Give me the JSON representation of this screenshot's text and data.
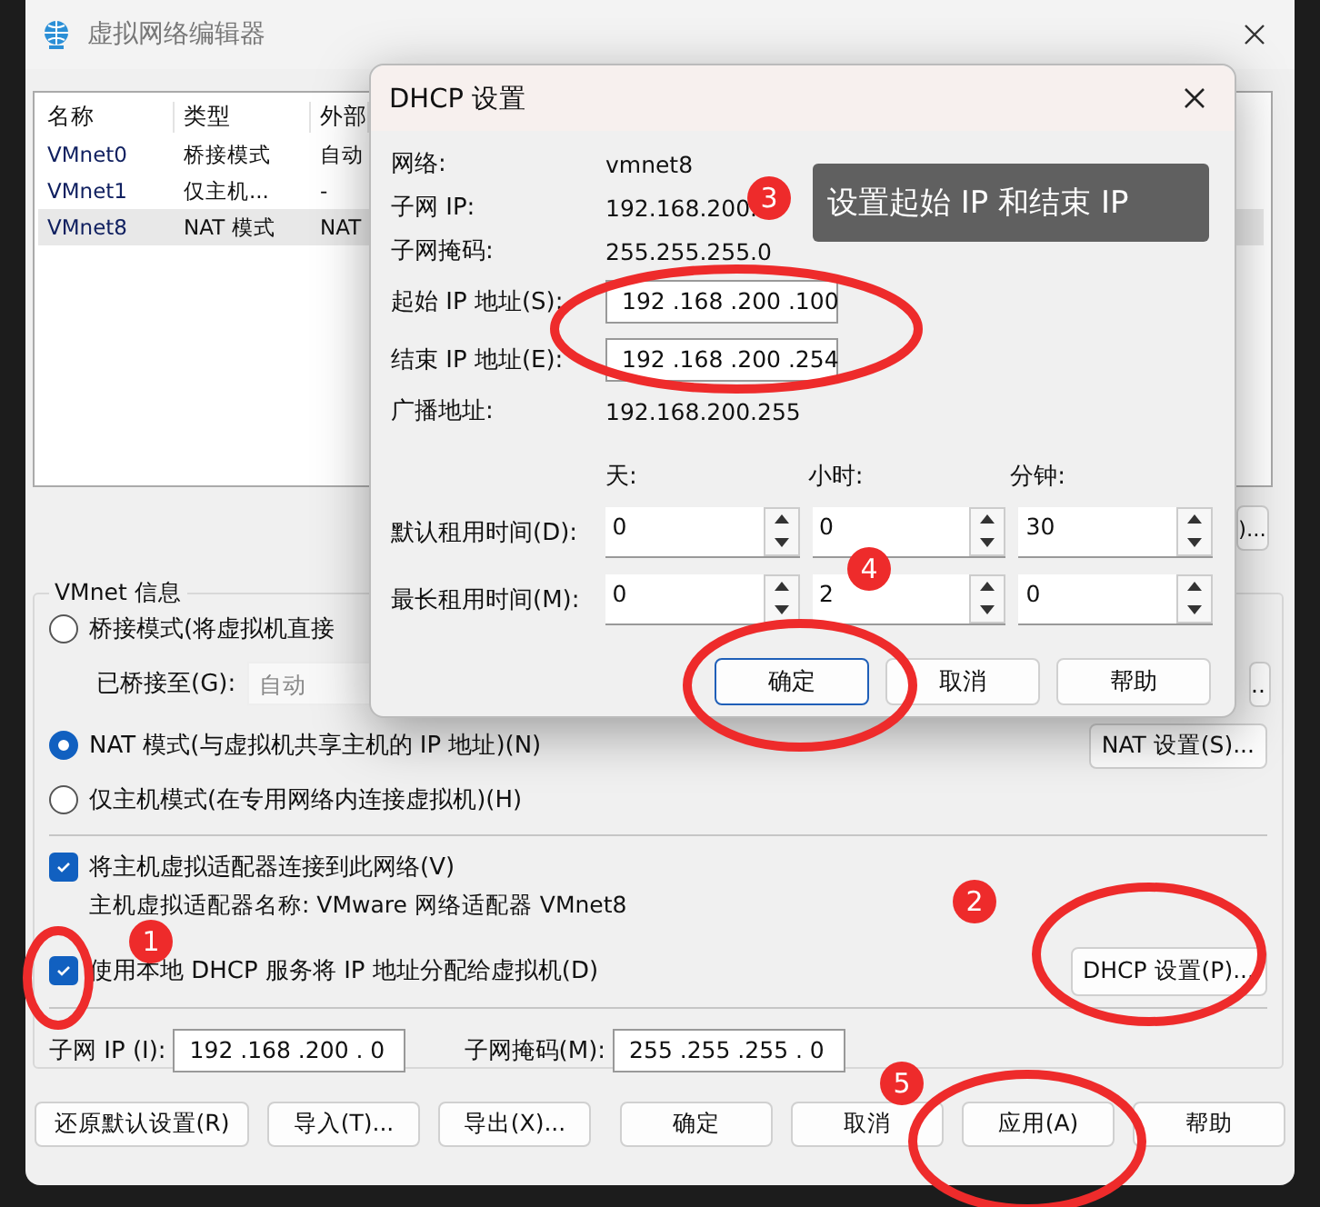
{
  "window": {
    "title": "虚拟网络编辑器"
  },
  "network_table": {
    "columns": [
      "名称",
      "类型",
      "外部"
    ],
    "rows": [
      {
        "cells": [
          "VMnet0",
          "桥接模式",
          "自动"
        ],
        "selected": false
      },
      {
        "cells": [
          "VMnet1",
          "仅主机...",
          "-"
        ],
        "selected": false
      },
      {
        "cells": [
          "VMnet8",
          "NAT 模式",
          "NAT"
        ],
        "selected": true
      }
    ]
  },
  "table_side_button": ")...",
  "vmnet_info": {
    "title": "VMnet 信息",
    "modes": [
      {
        "label": "桥接模式(将虚拟机直接",
        "selected": false
      },
      {
        "label": "NAT 模式(与虚拟机共享主机的 IP 地址)(N)",
        "selected": true
      },
      {
        "label": "仅主机模式(在专用网络内连接虚拟机)(H)",
        "selected": false
      }
    ],
    "bridged_to": {
      "label": "已桥接至(G):",
      "value": "自动",
      "disabled": true
    },
    "bridge_settings_button": "..",
    "nat_button": "NAT 设置(S)...",
    "connect_adapter": {
      "label": "将主机虚拟适配器连接到此网络(V)",
      "checked": true
    },
    "adapter_name": "主机虚拟适配器名称: VMware 网络适配器 VMnet8",
    "use_dhcp": {
      "label": "使用本地 DHCP 服务将 IP 地址分配给虚拟机(D)",
      "checked": true
    },
    "dhcp_button": "DHCP 设置(P)...",
    "subnet_ip": {
      "label": "子网 IP (I):",
      "value": "192 .168 .200 . 0"
    },
    "subnet_mask": {
      "label": "子网掩码(M):",
      "value": "255 .255 .255 . 0"
    }
  },
  "buttons": [
    "还原默认设置(R)",
    "导入(T)...",
    "导出(X)...",
    "确定",
    "取消",
    "应用(A)",
    "帮助"
  ],
  "dhcp_dialog": {
    "title": "DHCP 设置",
    "info": [
      {
        "label": "网络:",
        "value": "vmnet8"
      },
      {
        "label": "子网 IP:",
        "value": "192.168.200."
      },
      {
        "label": "子网掩码:",
        "value": "255.255.255.0"
      }
    ],
    "start_ip": {
      "label": "起始 IP 地址(S):",
      "value": "192 .168 .200 .100"
    },
    "end_ip": {
      "label": "结束 IP 地址(E):",
      "value": "192 .168 .200 .254"
    },
    "broadcast": {
      "label": "广播地址:",
      "value": "192.168.200.255"
    },
    "lease_columns": [
      "天:",
      "小时:",
      "分钟:"
    ],
    "leases": [
      {
        "label": "默认租用时间(D):",
        "values": [
          "0",
          "0",
          "30"
        ]
      },
      {
        "label": "最长租用时间(M):",
        "values": [
          "0",
          "2",
          "0"
        ]
      }
    ],
    "buttons": [
      {
        "label": "确定",
        "focused": true
      },
      {
        "label": "取消",
        "focused": false
      },
      {
        "label": "帮助",
        "focused": false
      }
    ]
  },
  "tooltip": "设置起始 IP 和结束 IP",
  "annotations": [
    "1",
    "2",
    "3",
    "4",
    "5"
  ]
}
